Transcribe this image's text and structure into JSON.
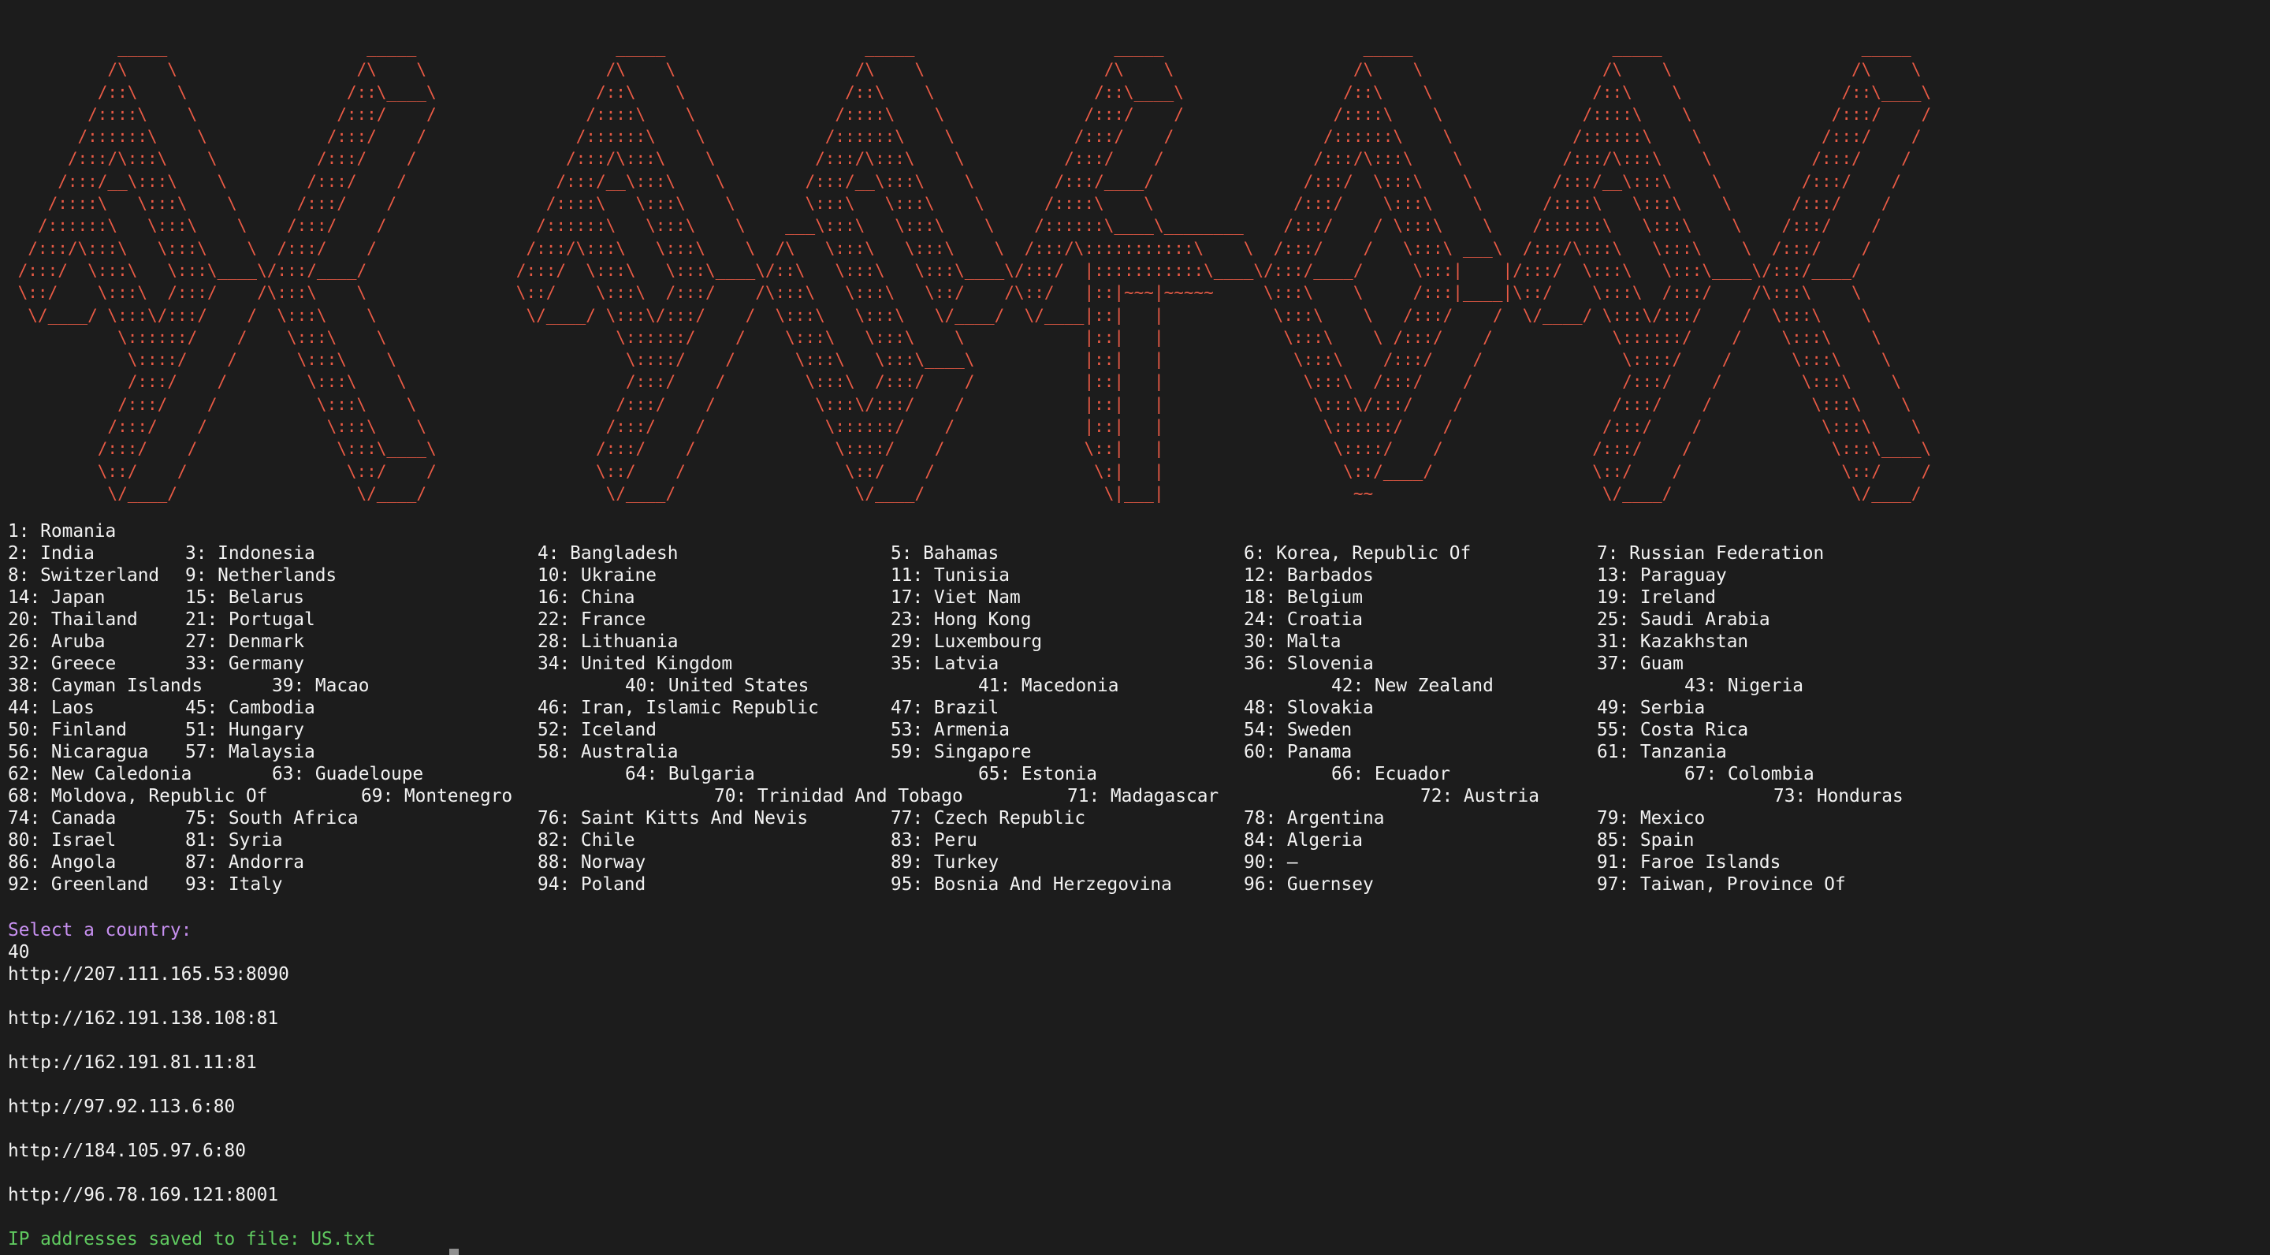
{
  "banner": {
    "ascii_art": "           _____                    _____                    _____                    _____                    _____                    _____                    _____                    _____          \n          /\\    \\                  /\\    \\                  /\\    \\                  /\\    \\                  /\\    \\                  /\\    \\                  /\\    \\                  /\\    \\         \n         /::\\    \\                /::\\____\\                /::\\    \\                /::\\    \\                /::\\____\\                /::\\    \\                /::\\    \\                /::\\____\\        \n        /::::\\    \\              /:::/    /               /::::\\    \\              /::::\\    \\              /:::/    /               /::::\\    \\              /::::\\    \\              /:::/    /        \n       /::::::\\    \\            /:::/    /               /::::::\\    \\            /::::::\\    \\            /:::/    /               /::::::\\    \\            /::::::\\    \\            /:::/    /         \n      /:::/\\:::\\    \\          /:::/    /               /:::/\\:::\\    \\          /:::/\\:::\\    \\          /:::/    /               /:::/\\:::\\    \\          /:::/\\:::\\    \\          /:::/    /          \n     /:::/__\\:::\\    \\        /:::/    /               /:::/__\\:::\\    \\        /:::/__\\:::\\    \\        /:::/____/               /:::/  \\:::\\    \\        /:::/__\\:::\\    \\        /:::/    /           \n    /::::\\   \\:::\\    \\      /:::/    /               /::::\\   \\:::\\    \\       \\:::\\   \\:::\\    \\      /::::\\    \\              /:::/    \\:::\\    \\      /::::\\   \\:::\\    \\      /:::/    /            \n   /::::::\\   \\:::\\    \\    /:::/    /               /::::::\\   \\:::\\    \\    ___\\:::\\   \\:::\\    \\    /::::::\\____\\________    /:::/    / \\:::\\    \\    /::::::\\   \\:::\\    \\    /:::/    /             \n  /:::/\\:::\\   \\:::\\    \\  /:::/    /               /:::/\\:::\\   \\:::\\    \\  /\\   \\:::\\   \\:::\\    \\  /:::/\\:::::::::::\\    \\  /:::/    /   \\:::\\ ___\\  /:::/\\:::\\   \\:::\\    \\  /:::/    /              \n /:::/  \\:::\\   \\:::\\____\\/:::/____/               /:::/  \\:::\\   \\:::\\____\\/::\\   \\:::\\   \\:::\\____\\/:::/  |:::::::::::\\____\\/:::/____/     \\:::|    |/:::/  \\:::\\   \\:::\\____\\/:::/____/               \n \\::/    \\:::\\  /:::/    /\\:::\\    \\               \\::/    \\:::\\  /:::/    /\\:::\\   \\:::\\   \\::/    /\\::/   |::|~~~|~~~~~     \\:::\\    \\     /:::|____|\\::/    \\:::\\  /:::/    /\\:::\\    \\               \n  \\/____/ \\:::\\/:::/    /  \\:::\\    \\               \\/____/ \\:::\\/:::/    /  \\:::\\   \\:::\\   \\/____/  \\/____|::|   |           \\:::\\    \\   /:::/    /  \\/____/ \\:::\\/:::/    /  \\:::\\    \\              \n           \\::::::/    /    \\:::\\    \\                       \\::::::/    /    \\:::\\   \\:::\\    \\            |::|   |            \\:::\\    \\ /:::/    /            \\::::::/    /    \\:::\\    \\             \n            \\::::/    /      \\:::\\    \\                       \\::::/    /      \\:::\\   \\:::\\____\\           |::|   |             \\:::\\    /:::/    /              \\::::/    /      \\:::\\    \\            \n            /:::/    /        \\:::\\    \\                      /:::/    /        \\:::\\  /:::/    /           |::|   |              \\:::\\  /:::/    /               /:::/    /        \\:::\\    \\           \n           /:::/    /          \\:::\\    \\                    /:::/    /          \\:::\\/:::/    /            |::|   |               \\:::\\/:::/    /               /:::/    /          \\:::\\    \\          \n          /:::/    /            \\:::\\    \\                  /:::/    /            \\::::::/    /             |::|   |                \\::::::/    /               /:::/    /            \\:::\\    \\         \n         /:::/    /              \\:::\\____\\                /:::/    /              \\::::/    /              \\::|   |                 \\::::/    /               /:::/    /              \\:::\\____\\        \n         \\::/    /                \\::/    /                \\::/    /                \\::/    /                \\:|   |                  \\::/____/                \\::/    /                \\::/    /        \n          \\/____/                  \\/____/                  \\/____/                  \\/____/                  \\|___|                   ~~                       \\/____/                  \\/____/         "
  },
  "country_list": [
    {
      "top": "1: Romania"
    },
    {
      "cols": [
        "2: India",
        "3: Indonesia",
        "4: Bangladesh",
        "5: Bahamas",
        "6: Korea, Republic Of",
        "7: Russian Federation"
      ]
    },
    {
      "cols": [
        "8: Switzerland",
        "9: Netherlands",
        "10: Ukraine",
        "11: Tunisia",
        "12: Barbados",
        "13: Paraguay"
      ]
    },
    {
      "cols": [
        "14: Japan",
        "15: Belarus",
        "16: China",
        "17: Viet Nam",
        "18: Belgium",
        "19: Ireland"
      ]
    },
    {
      "cols": [
        "20: Thailand",
        "21: Portugal",
        "22: France",
        "23: Hong Kong",
        "24: Croatia",
        "25: Saudi Arabia"
      ]
    },
    {
      "cols": [
        "26: Aruba",
        "27: Denmark",
        "28: Lithuania",
        "29: Luxembourg",
        "30: Malta",
        "31: Kazakhstan"
      ]
    },
    {
      "cols": [
        "32: Greece",
        "33: Germany",
        "34: United Kingdom",
        "35: Latvia",
        "36: Slovenia",
        "37: Guam"
      ]
    },
    {
      "cols": [
        "38: Cayman Islands",
        "39: Macao",
        "40: United States",
        "41: Macedonia",
        "42: New Zealand",
        "43: Nigeria"
      ]
    },
    {
      "cols": [
        "44: Laos",
        "45: Cambodia",
        "46: Iran, Islamic Republic",
        "47: Brazil",
        "48: Slovakia",
        "49: Serbia"
      ]
    },
    {
      "cols": [
        "50: Finland",
        "51: Hungary",
        "52: Iceland",
        "53: Armenia",
        "54: Sweden",
        "55: Costa Rica"
      ]
    },
    {
      "cols": [
        "56: Nicaragua",
        "57: Malaysia",
        "58: Australia",
        "59: Singapore",
        "60: Panama",
        "61: Tanzania"
      ]
    },
    {
      "cols": [
        "62: New Caledonia",
        "63: Guadeloupe",
        "64: Bulgaria",
        "65: Estonia",
        "66: Ecuador",
        "67: Colombia"
      ]
    },
    {
      "cols": [
        "68: Moldova, Republic Of",
        "69: Montenegro",
        "70: Trinidad And Tobago",
        "71: Madagascar",
        "72: Austria",
        "73: Honduras"
      ]
    },
    {
      "cols": [
        "74: Canada",
        "75: South Africa",
        "76: Saint Kitts And Nevis",
        "77: Czech Republic",
        "78: Argentina",
        "79: Mexico"
      ]
    },
    {
      "cols": [
        "80: Israel",
        "81: Syria",
        "82: Chile",
        "83: Peru",
        "84: Algeria",
        "85: Spain"
      ]
    },
    {
      "cols": [
        "86: Angola",
        "87: Andorra",
        "88: Norway",
        "89: Turkey",
        "90: –",
        "91: Faroe Islands"
      ]
    },
    {
      "cols": [
        "92: Greenland",
        "93: Italy",
        "94: Poland",
        "95: Bosnia And Herzegovina",
        "96: Guernsey",
        "97: Taiwan, Province Of"
      ]
    }
  ],
  "prompt": {
    "label": "Select a country:",
    "input": "40"
  },
  "results": [
    "http://207.111.165.53:8090",
    "http://162.191.138.108:81",
    "http://162.191.81.11:81",
    "http://97.92.113.6:80",
    "http://184.105.97.6:80",
    "http://96.78.169.121:8001"
  ],
  "status": {
    "saved": "IP addresses saved to file: US.txt"
  },
  "colors": {
    "background": "#1c1c1c",
    "banner": "#e85a45",
    "prompt": "#c790f0",
    "success": "#5fc95f",
    "text": "#f2f2f2"
  }
}
